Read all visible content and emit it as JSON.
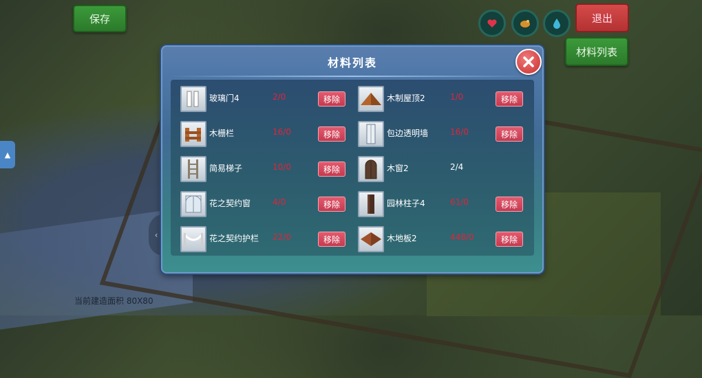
{
  "top_bar": {
    "save_label": "保存",
    "exit_label": "退出",
    "materials_label": "材料列表"
  },
  "status_icons": [
    "heart-icon",
    "food-icon",
    "water-drop-icon"
  ],
  "footer": {
    "build_area": "当前建造面积 80X80"
  },
  "dialog": {
    "title": "材料列表",
    "remove_label": "移除",
    "items_left": [
      {
        "name": "玻璃门4",
        "count": "2/0",
        "icon": "glass-door-icon",
        "enough": false
      },
      {
        "name": "木栅栏",
        "count": "16/0",
        "icon": "wood-fence-icon",
        "enough": false
      },
      {
        "name": "简易梯子",
        "count": "10/0",
        "icon": "ladder-icon",
        "enough": false
      },
      {
        "name": "花之契约窗",
        "count": "4/0",
        "icon": "flower-window-icon",
        "enough": false
      },
      {
        "name": "花之契约护栏",
        "count": "22/0",
        "icon": "flower-railing-icon",
        "enough": false
      }
    ],
    "items_right": [
      {
        "name": "木制屋顶2",
        "count": "1/0",
        "icon": "wood-roof-icon",
        "enough": false
      },
      {
        "name": "包边透明墙",
        "count": "16/0",
        "icon": "glass-wall-icon",
        "enough": false
      },
      {
        "name": "木窗2",
        "count": "2/4",
        "icon": "wood-window-icon",
        "enough": true
      },
      {
        "name": "园林柱子4",
        "count": "61/0",
        "icon": "garden-pillar-icon",
        "enough": false
      },
      {
        "name": "木地板2",
        "count": "448/0",
        "icon": "wood-floor-icon",
        "enough": false
      }
    ]
  },
  "colors": {
    "insufficient": "#e0243a",
    "sufficient": "#ffffff",
    "dialog_bg": "#4f78a8"
  }
}
